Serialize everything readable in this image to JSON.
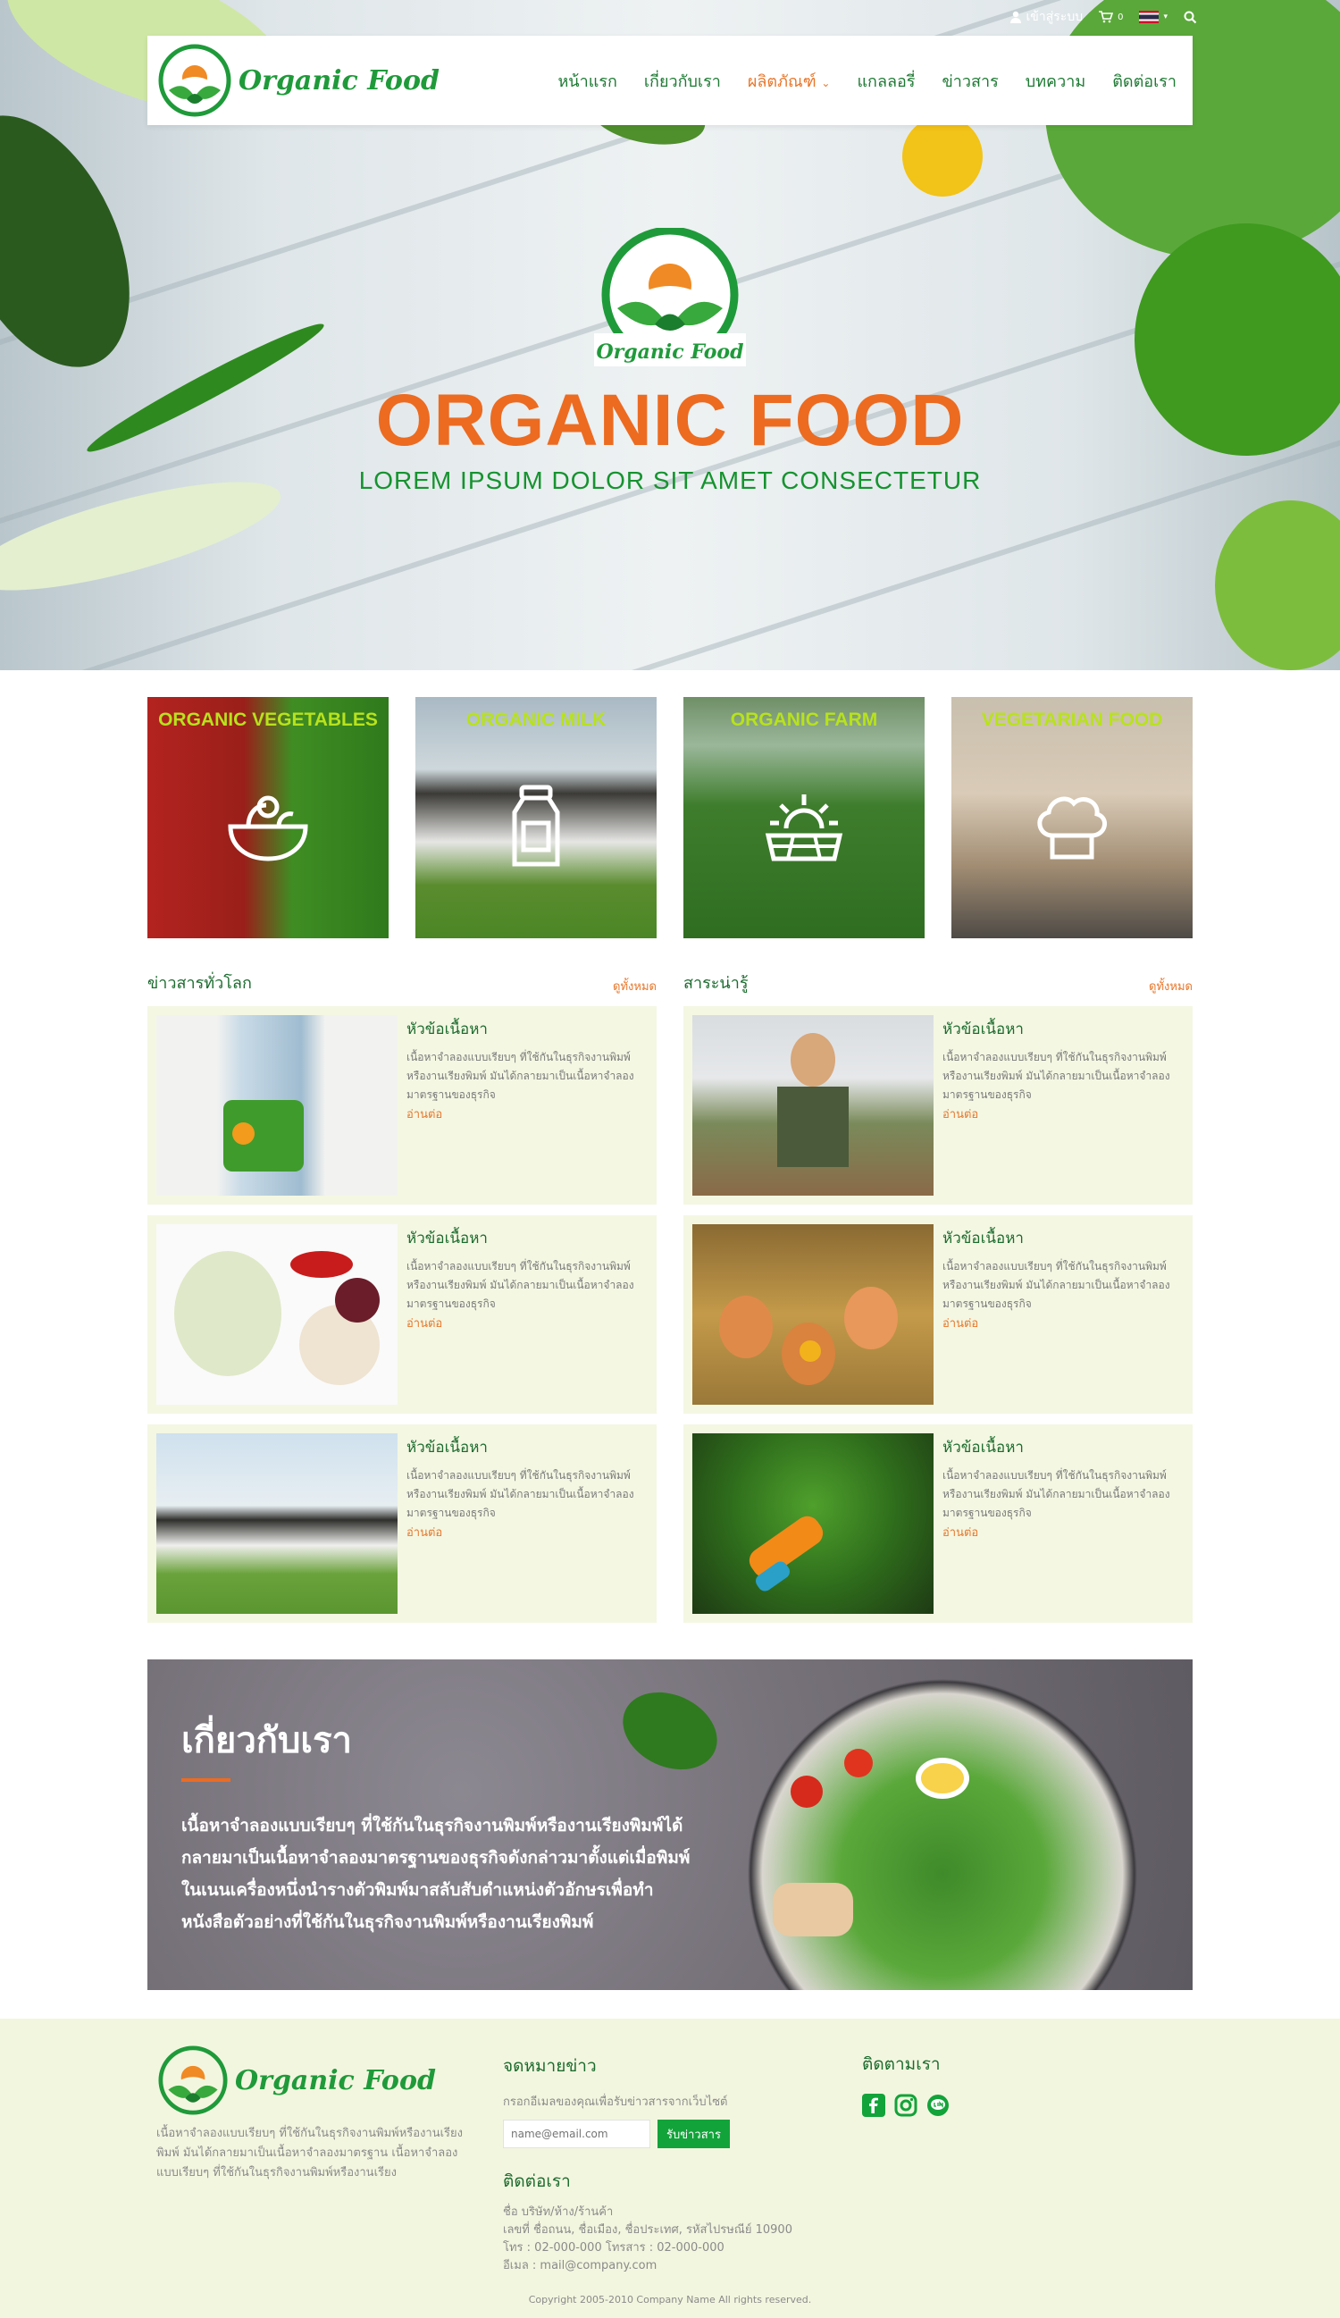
{
  "topbar": {
    "login": "เข้าสู่ระบบ",
    "cart_count": "0"
  },
  "brand": {
    "name": "Organic Food"
  },
  "nav": {
    "items": [
      {
        "label": "หน้าแรก"
      },
      {
        "label": "เกี่ยวกับเรา"
      },
      {
        "label": "ผลิตภัณฑ์"
      },
      {
        "label": "แกลลอรี่"
      },
      {
        "label": "ข่าวสาร"
      },
      {
        "label": "บทความ"
      },
      {
        "label": "ติดต่อเรา"
      }
    ],
    "active_color": "#e8762a"
  },
  "hero": {
    "logo_text": "Organic Food",
    "title": "ORGANIC FOOD",
    "subtitle": "LOREM IPSUM DOLOR SIT AMET CONSECTETUR"
  },
  "categories": [
    {
      "title": "ORGANIC VEGETABLES",
      "icon": "vegetable-bowl-icon"
    },
    {
      "title": "ORGANIC MILK",
      "icon": "milk-can-icon"
    },
    {
      "title": "ORGANIC FARM",
      "icon": "sunrise-field-icon"
    },
    {
      "title": "VEGETARIAN FOOD",
      "icon": "chef-hat-icon"
    }
  ],
  "news_world": {
    "title": "ข่าวสารทั่วโลก",
    "view_all": "ดูทั้งหมด",
    "items": [
      {
        "title": "หัวข้อเนื้อหา",
        "text": "เนื้อหาจำลองแบบเรียบๆ ที่ใช้กันในธุรกิจงานพิมพ์หรืองานเรียงพิมพ์ มันได้กลายมาเป็นเนื้อหาจำลองมาตรฐานของธุรกิจ",
        "more": "อ่านต่อ"
      },
      {
        "title": "หัวข้อเนื้อหา",
        "text": "เนื้อหาจำลองแบบเรียบๆ ที่ใช้กันในธุรกิจงานพิมพ์หรืองานเรียงพิมพ์ มันได้กลายมาเป็นเนื้อหาจำลองมาตรฐานของธุรกิจ",
        "more": "อ่านต่อ"
      },
      {
        "title": "หัวข้อเนื้อหา",
        "text": "เนื้อหาจำลองแบบเรียบๆ ที่ใช้กันในธุรกิจงานพิมพ์หรืองานเรียงพิมพ์ มันได้กลายมาเป็นเนื้อหาจำลองมาตรฐานของธุรกิจ",
        "more": "อ่านต่อ"
      }
    ]
  },
  "knowledge": {
    "title": "สาระน่ารู้",
    "view_all": "ดูทั้งหมด",
    "items": [
      {
        "title": "หัวข้อเนื้อหา",
        "text": "เนื้อหาจำลองแบบเรียบๆ ที่ใช้กันในธุรกิจงานพิมพ์หรืองานเรียงพิมพ์ มันได้กลายมาเป็นเนื้อหาจำลองมาตรฐานของธุรกิจ",
        "more": "อ่านต่อ"
      },
      {
        "title": "หัวข้อเนื้อหา",
        "text": "เนื้อหาจำลองแบบเรียบๆ ที่ใช้กันในธุรกิจงานพิมพ์หรืองานเรียงพิมพ์ มันได้กลายมาเป็นเนื้อหาจำลองมาตรฐานของธุรกิจ",
        "more": "อ่านต่อ"
      },
      {
        "title": "หัวข้อเนื้อหา",
        "text": "เนื้อหาจำลองแบบเรียบๆ ที่ใช้กันในธุรกิจงานพิมพ์หรืองานเรียงพิมพ์ มันได้กลายมาเป็นเนื้อหาจำลองมาตรฐานของธุรกิจ",
        "more": "อ่านต่อ"
      }
    ]
  },
  "about": {
    "title": "เกี่ยวกับเรา",
    "text": "เนื้อหาจำลองแบบเรียบๆ ที่ใช้กันในธุรกิจงานพิมพ์หรืองานเรียงพิมพ์ได้กลายมาเป็นเนื้อหาจำลองมาตรฐานของธุรกิจดังกล่าวมาตั้งแต่เมื่อพิมพ์ในเนนเครื่องหนึ่งนำรางตัวพิมพ์มาสลับสับตำแหน่งตัวอักษรเพื่อทำหนังสือตัวอย่างที่ใช้กันในธุรกิจงานพิมพ์หรืองานเรียงพิมพ์"
  },
  "footer": {
    "brand": "Organic Food",
    "desc": "เนื้อหาจำลองแบบเรียบๆ ที่ใช้กันในธุรกิจงานพิมพ์หรืองานเรียงพิมพ์ มันได้กลายมาเป็นเนื้อหาจำลองมาตรฐาน เนื้อหาจำลองแบบเรียบๆ ที่ใช้กันในธุรกิจงานพิมพ์หรืองานเรียง",
    "newsletter_title": "จดหมายข่าว",
    "newsletter_desc": "กรอกอีเมลของคุณเพื่อรับข่าวสารจากเว็บไซต์",
    "newsletter_placeholder": "name@email.com",
    "newsletter_button": "รับข่าวสาร",
    "contact_title": "ติดต่อเรา",
    "contact_lines": [
      "ชื่อ บริษัท/ห้าง/ร้านค้า",
      "เลขที่ ชื่อถนน, ชื่อเมือง, ชื่อประเทศ, รหัสไปรษณีย์ 10900",
      "โทร : 02-000-000 โทรสาร : 02-000-000",
      "อีเมล : mail@company.com"
    ],
    "follow_title": "ติดตามเรา",
    "social": [
      "facebook-icon",
      "instagram-icon",
      "line-icon"
    ],
    "copyright": "Copyright 2005-2010 Company Name All rights reserved."
  }
}
